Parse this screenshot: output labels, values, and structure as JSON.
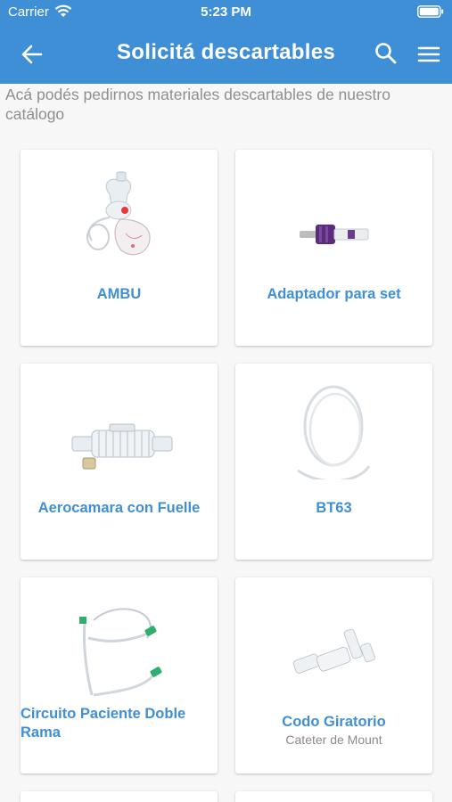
{
  "status_bar": {
    "carrier": "Carrier",
    "time": "5:23 PM"
  },
  "app_bar": {
    "title": "Solicitá descartables"
  },
  "intro": "Acá podés pedirnos materiales descartables de nuestro catálogo",
  "products": [
    {
      "name": "AMBU",
      "subtitle": ""
    },
    {
      "name": "Adaptador para set",
      "subtitle": ""
    },
    {
      "name": "Aerocamara con Fuelle",
      "subtitle": ""
    },
    {
      "name": "BT63",
      "subtitle": ""
    },
    {
      "name": "Circuito Paciente Doble Rama",
      "subtitle": ""
    },
    {
      "name": "Codo Giratorio",
      "subtitle": "Cateter de Mount"
    }
  ],
  "colors": {
    "primary": "#3f8fd6",
    "background": "#f7f7f7",
    "card": "#ffffff",
    "muted": "#8f8f8f"
  }
}
